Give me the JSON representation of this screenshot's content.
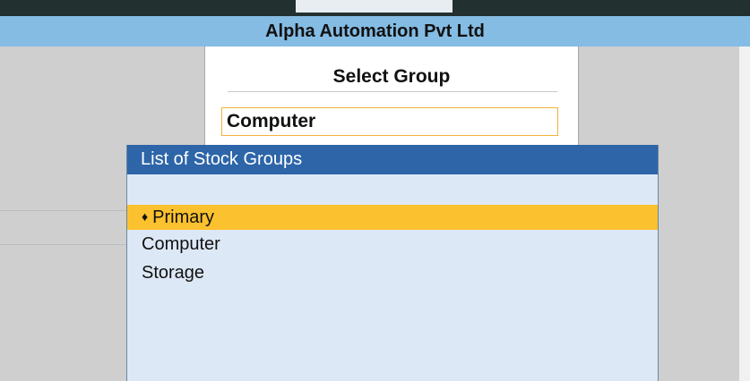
{
  "company_name": "Alpha Automation Pvt Ltd",
  "select_group": {
    "title": "Select Group",
    "input_value": "Computer"
  },
  "stock_groups_list": {
    "title": "List of Stock Groups",
    "items": [
      {
        "label": "Primary",
        "marker": "♦",
        "selected": true
      },
      {
        "label": "Computer",
        "selected": false
      },
      {
        "label": "Storage",
        "selected": false
      }
    ]
  },
  "colors": {
    "company_bar": "#84bce3",
    "list_header": "#2d65a8",
    "selection_highlight": "#fbc12e",
    "input_border": "#f0b43a"
  }
}
